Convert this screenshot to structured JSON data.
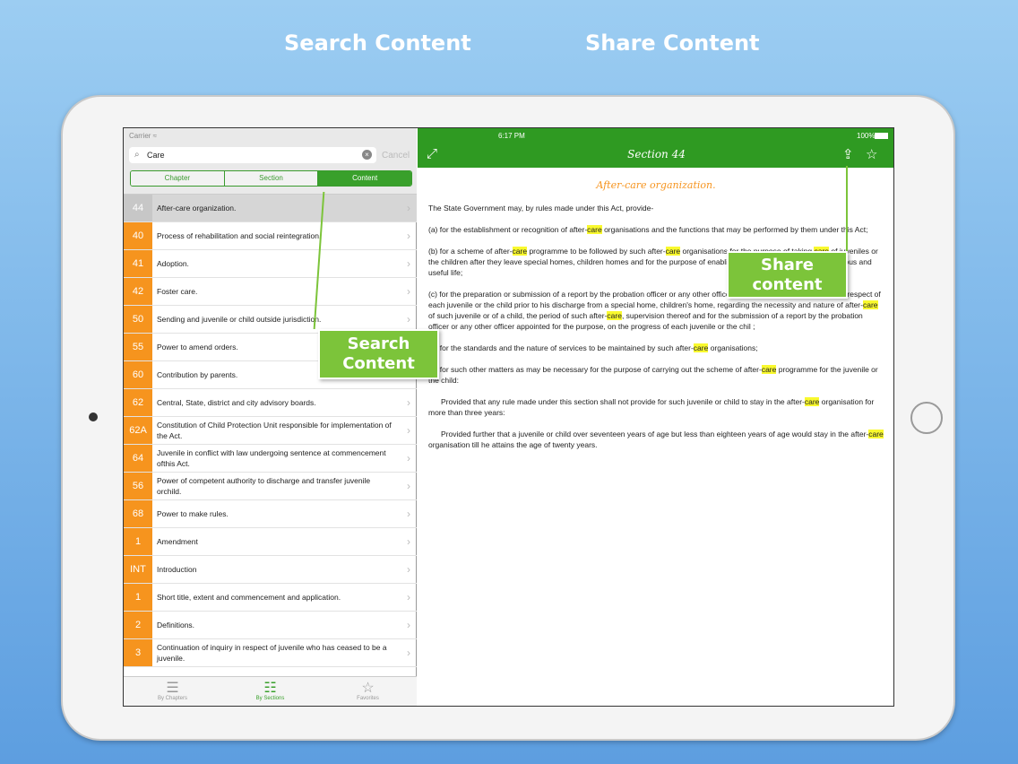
{
  "headlines": {
    "left": "Search Content",
    "right": "Share Content"
  },
  "left_pane": {
    "status": {
      "carrier": "Carrier ≈"
    },
    "search": {
      "value": "Care",
      "cancel_label": "Cancel",
      "clear_glyph": "×"
    },
    "segments": [
      {
        "label": "Chapter",
        "selected": false
      },
      {
        "label": "Section",
        "selected": false
      },
      {
        "label": "Content",
        "selected": true
      }
    ],
    "rows": [
      {
        "num": "44",
        "text": "After-care organization.",
        "selected": true
      },
      {
        "num": "40",
        "text": "Process of rehabilitation and social reintegration."
      },
      {
        "num": "41",
        "text": "Adoption."
      },
      {
        "num": "42",
        "text": "Foster care."
      },
      {
        "num": "50",
        "text": "Sending and juvenile or child outside jurisdiction."
      },
      {
        "num": "55",
        "text": "Power to amend orders."
      },
      {
        "num": "60",
        "text": "Contribution by parents."
      },
      {
        "num": "62",
        "text": "Central, State, district and city advisory boards."
      },
      {
        "num": "62A",
        "text": "Constitution of Child Protection Unit responsible for implementation of the Act."
      },
      {
        "num": "64",
        "text": "Juvenile in conflict with law undergoing sentence at commencement ofthis Act."
      },
      {
        "num": "56",
        "text": "Power of competent authority to discharge and transfer juvenile orchild."
      },
      {
        "num": "68",
        "text": "Power to make rules."
      },
      {
        "num": "1",
        "text": "Amendment"
      },
      {
        "num": "INT",
        "text": "Introduction"
      },
      {
        "num": "1",
        "text": "Short title, extent and commencement and application."
      },
      {
        "num": "2",
        "text": "Definitions."
      },
      {
        "num": "3",
        "text": "Continuation of inquiry in respect of juvenile who has ceased to be a juvenile."
      }
    ],
    "tabs": [
      {
        "label": "By Chapters",
        "icon": "list-icon",
        "active": false
      },
      {
        "label": "By Sections",
        "icon": "list-bullets-icon",
        "active": true
      },
      {
        "label": "Favorites",
        "icon": "star-icon",
        "active": false
      }
    ]
  },
  "right_pane": {
    "status": {
      "time": "6:17 PM",
      "battery": "100%"
    },
    "title": "Section 44",
    "icons": {
      "expand": "expand-icon",
      "share": "share-icon",
      "favorite": "star-icon"
    },
    "doc_title": "After-care organization.",
    "paragraphs": [
      {
        "indent": false,
        "parts": [
          "The State Government may, by rules made under this Act, provide-"
        ]
      },
      {
        "indent": false,
        "parts": [
          "(a) for the establishment or recognition of after-",
          "care",
          " organisations and the functions that may be performed by them under this Act;"
        ]
      },
      {
        "indent": false,
        "parts": [
          "(b) for a scheme of after-",
          "care",
          " programme to be followed by such after-",
          "care",
          " organisations for the purpose of taking ",
          "care",
          " of juveniles or the children after they leave special homes, children homes and for the purpose of enabling them to lead an honest, industrious and useful life;"
        ]
      },
      {
        "indent": false,
        "parts": [
          "(c) for the preparation or submission of a report by the probation officer or any other officer appointed by that Government in respect of each juvenile or the child prior to his discharge from a special home, children's home, regarding the necessity and nature of after-",
          "care",
          " of such juvenile or of a child, the period of such after-",
          "care",
          ", supervision thereof and for the submission of a report by the probation officer or any other officer appointed for the purpose, on the progress of each juvenile or the chil ;"
        ]
      },
      {
        "indent": false,
        "parts": [
          "(d) for the standards and the nature of services to be maintained by such after-",
          "care",
          " organisations;"
        ]
      },
      {
        "indent": false,
        "parts": [
          "(e) for such other matters as may be necessary for the purpose of carrying out the scheme of after-",
          "care",
          " programme for the juvenile or the child:"
        ]
      },
      {
        "indent": true,
        "parts": [
          "Provided that any rule made under this section shall not provide for such juvenile or child to stay in the after-",
          "care",
          " organisation for more than three years:"
        ]
      },
      {
        "indent": true,
        "parts": [
          "Provided further that a juvenile or child over seventeen years of age but less than eighteen years of age would stay in the after-",
          "care",
          " organisation till he attains the age of twenty years."
        ]
      }
    ]
  },
  "callouts": {
    "search": [
      "Search",
      "Content"
    ],
    "share": [
      "Share",
      "content"
    ]
  },
  "colors": {
    "green": "#2f9a22",
    "orange": "#f6941e",
    "highlight": "#f9f92e",
    "callout": "#7cc43a"
  }
}
